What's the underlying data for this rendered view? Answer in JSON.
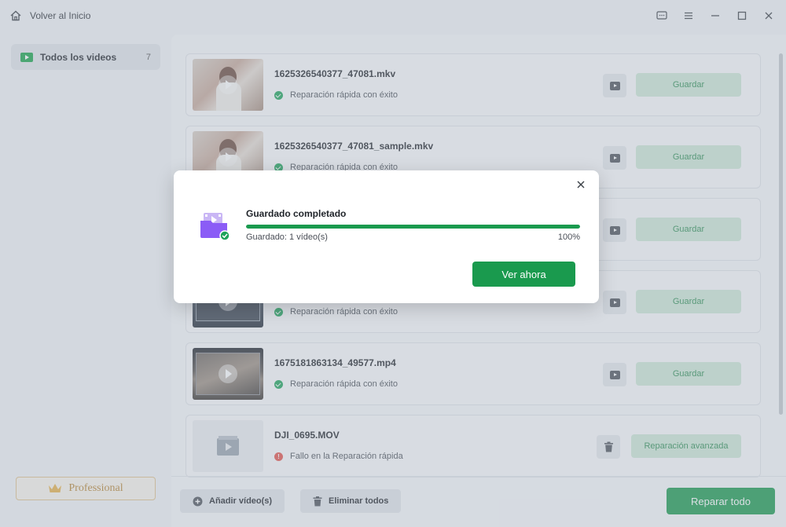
{
  "titlebar": {
    "home_label": "Volver al Inicio",
    "icons": [
      "chat-icon",
      "menu-icon",
      "minimize-icon",
      "maximize-icon",
      "close-icon"
    ]
  },
  "sidebar": {
    "all_videos_label": "Todos los videos",
    "all_videos_count": "7",
    "professional_label": "Professional"
  },
  "files": [
    {
      "name": "1625326540377_47081.mkv",
      "status": "Reparación rápida con éxito",
      "result": "ok",
      "action": "Guardar"
    },
    {
      "name": "1625326540377_47081_sample.mkv",
      "status": "Reparación rápida con éxito",
      "result": "ok",
      "action": "Guardar"
    },
    {
      "name": "",
      "status": "",
      "result": "ok",
      "action": "Guardar"
    },
    {
      "name": "",
      "status": "Reparación rápida con éxito",
      "result": "ok",
      "action": "Guardar"
    },
    {
      "name": "1675181863134_49577.mp4",
      "status": "Reparación rápida con éxito",
      "result": "ok",
      "action": "Guardar"
    },
    {
      "name": "DJI_0695.MOV",
      "status": "Fallo en la Reparación rápida",
      "result": "fail",
      "action": "Reparación avanzada"
    }
  ],
  "bottom": {
    "add_label": "Añadir vídeo(s)",
    "delete_label": "Eliminar todos",
    "repair_label": "Reparar todo"
  },
  "dialog": {
    "title": "Guardado completado",
    "progress_percent": 100,
    "subtitle": "Guardado: 1 vídeo(s)",
    "percent_label": "100%",
    "button_label": "Ver ahora"
  },
  "colors": {
    "accent": "#1a9a4e",
    "save_bg": "#cfe9d7",
    "error": "#e5534b"
  }
}
